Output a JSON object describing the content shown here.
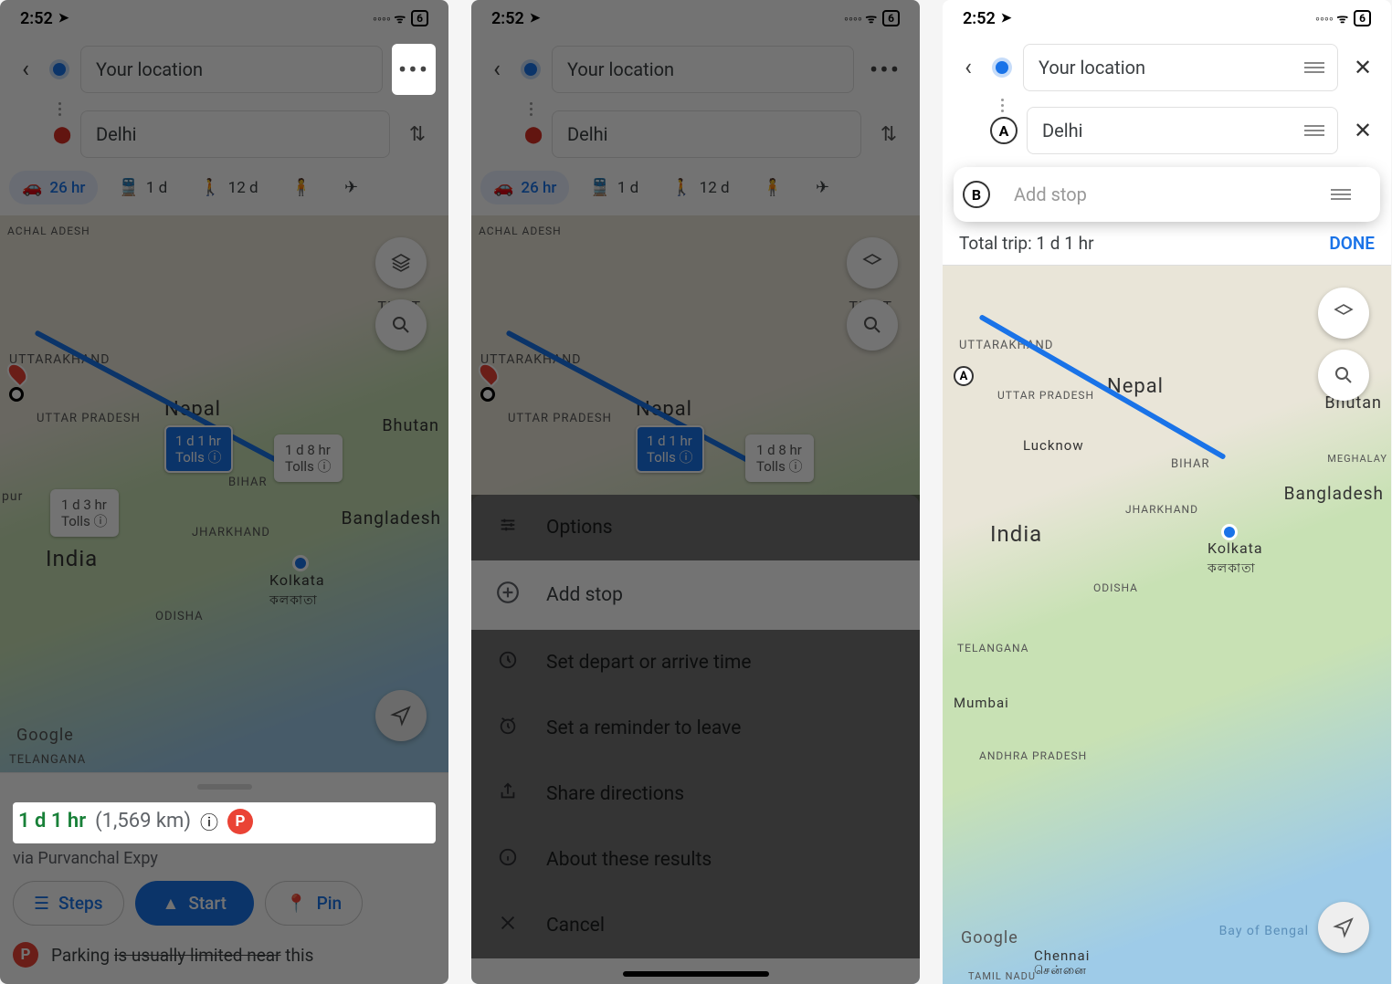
{
  "status": {
    "time": "2:52",
    "battery": "6"
  },
  "modes": {
    "car": "26 hr",
    "transit": "1 d",
    "walk": "12 d"
  },
  "panel1": {
    "origin": "Your location",
    "destination": "Delhi",
    "summary": {
      "duration": "1 d 1 hr",
      "distance": "(1,569 km)",
      "via": "via Purvanchal Expy"
    },
    "actions": {
      "steps": "Steps",
      "start": "Start",
      "pin": "Pin"
    },
    "parking_line": "Parking is usually limited near this"
  },
  "panel2": {
    "sheet": {
      "options": "Options",
      "add_stop": "Add stop",
      "set_time": "Set depart or arrive time",
      "reminder": "Set a reminder to leave",
      "share": "Share directions",
      "about": "About these results",
      "cancel": "Cancel"
    }
  },
  "panel3": {
    "origin": "Your location",
    "stop_a": "Delhi",
    "stop_b_placeholder": "Add stop",
    "total_trip_label": "Total trip: 1 d 1 hr",
    "done": "DONE"
  },
  "map_labels": {
    "tibet": "TIBET",
    "uttarakhand": "UTTARAKHAND",
    "uttar_pradesh": "UTTAR PRADESH",
    "nepal": "Nepal",
    "bhutan": "Bhutan",
    "bihar": "BIHAR",
    "jharkhand": "JHARKHAND",
    "bangladesh": "Bangladesh",
    "india": "India",
    "kolkata": "Kolkata",
    "kolkata_native": "কলকাতা",
    "odisha": "ODISHA",
    "telangana": "TELANGANA",
    "google": "Google",
    "lucknow": "Lucknow",
    "meghalay": "MEGHALAY",
    "mumbai": "Mumbai",
    "chennai": "Chennai",
    "chennai_native": "சென்னை",
    "bay": "Bay of Bengal",
    "andhra": "ANDHRA PRADESH",
    "tamil": "TAMIL NADU",
    "achal": "ACHAL ADESH",
    "pur": "pur"
  },
  "route_bubbles": {
    "main": {
      "line1": "1 d 1 hr",
      "line2": "Tolls ⓘ"
    },
    "alt1": {
      "line1": "1 d 8 hr",
      "line2": "Tolls ⓘ"
    },
    "alt2": {
      "line1": "1 d 3 hr",
      "line2": "Tolls ⓘ"
    }
  }
}
